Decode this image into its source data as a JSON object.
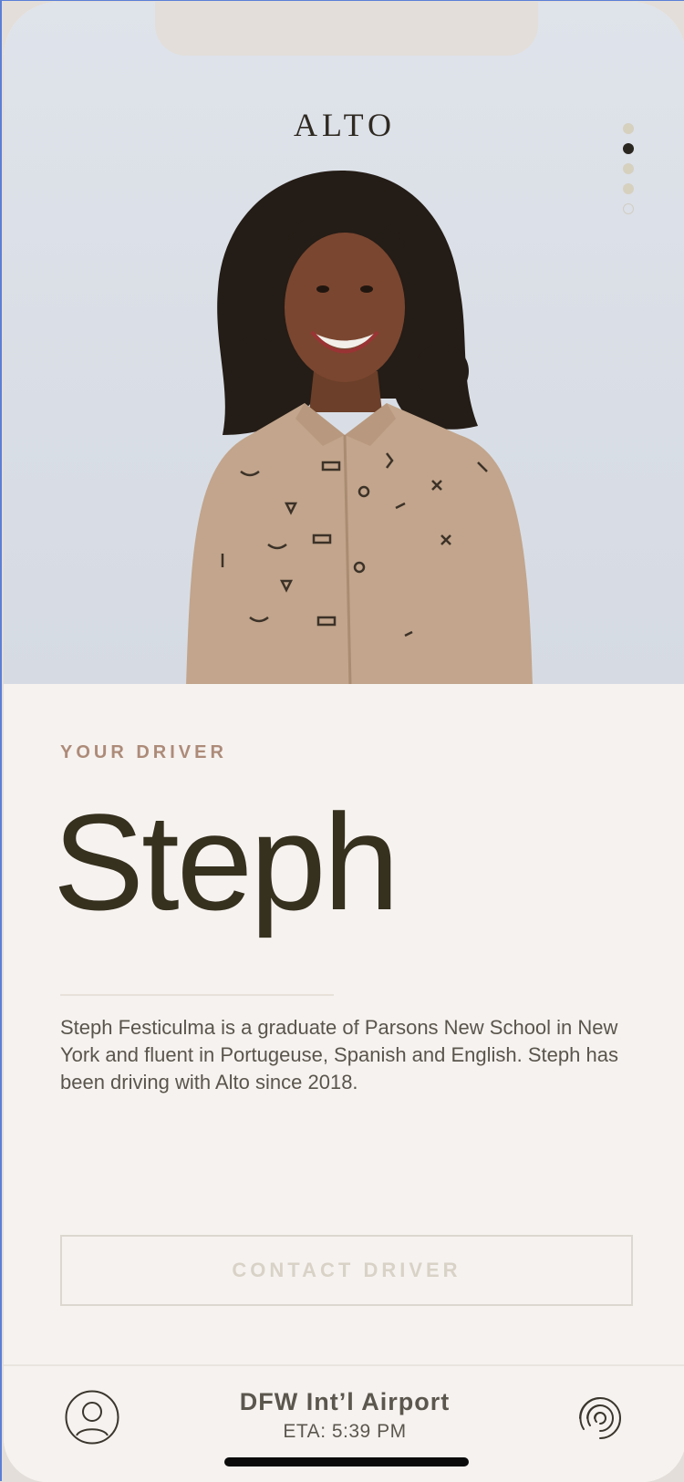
{
  "app": {
    "logo": "ALTO"
  },
  "carousel": {
    "dots_count": 5,
    "active_index": 1
  },
  "driver": {
    "eyebrow": "YOUR DRIVER",
    "name": "Steph",
    "bio": "Steph Festiculma is a graduate of Parsons New School in New York and fluent in Portugeuse, Spanish and English. Steph has been driving with Alto since 2018.",
    "contact_label": "CONTACT DRIVER"
  },
  "trip": {
    "destination": "DFW Int’l Airport",
    "eta": "ETA: 5:39 PM"
  },
  "icons": {
    "profile": "user-icon",
    "spiral": "spiral-icon"
  },
  "colors": {
    "accent_eyebrow": "#ad8b79",
    "name_text": "#36301f",
    "background": "#f6f2ef",
    "hero_background": "#dfe3ea"
  }
}
